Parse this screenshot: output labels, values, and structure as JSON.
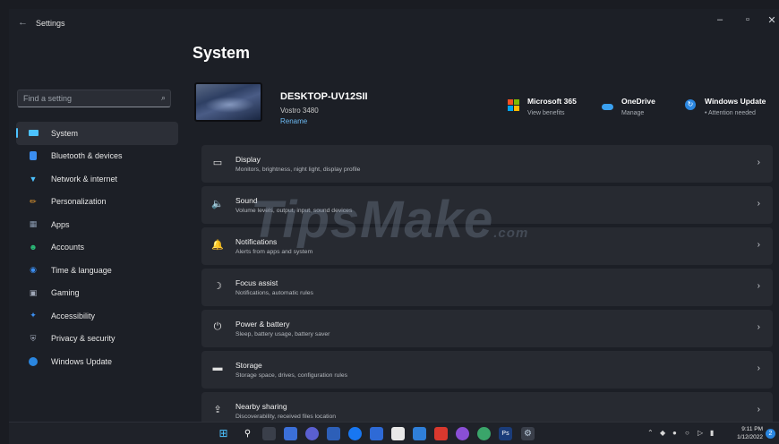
{
  "window": {
    "back_icon": "←",
    "title": "Settings",
    "minimize": "–",
    "maximize": "▫",
    "close": "✕"
  },
  "search": {
    "placeholder": "Find a setting",
    "icon": "search-icon"
  },
  "sidebar": {
    "items": [
      {
        "label": "System",
        "icon": "system-icon",
        "active": true,
        "color": "#4cc2ff"
      },
      {
        "label": "Bluetooth & devices",
        "icon": "bluetooth-icon",
        "color": "#3b8ef0"
      },
      {
        "label": "Network & internet",
        "icon": "wifi-icon",
        "color": "#4cc2ff"
      },
      {
        "label": "Personalization",
        "icon": "brush-icon",
        "color": "#f0a030"
      },
      {
        "label": "Apps",
        "icon": "apps-icon",
        "color": "#8a9ab0"
      },
      {
        "label": "Accounts",
        "icon": "person-icon",
        "color": "#2bbf7a"
      },
      {
        "label": "Time & language",
        "icon": "globe-icon",
        "color": "#3b8ef0"
      },
      {
        "label": "Gaming",
        "icon": "controller-icon",
        "color": "#a0a8b8"
      },
      {
        "label": "Accessibility",
        "icon": "accessibility-icon",
        "color": "#3b8ef0"
      },
      {
        "label": "Privacy & security",
        "icon": "shield-icon",
        "color": "#a0a8b8"
      },
      {
        "label": "Windows Update",
        "icon": "update-icon",
        "color": "#2a86e0"
      }
    ]
  },
  "main": {
    "title": "System",
    "device": {
      "name": "DESKTOP-UV12SII",
      "model": "Vostro 3480",
      "rename": "Rename"
    },
    "quick": [
      {
        "title": "Microsoft 365",
        "sub": "View benefits",
        "icon": "microsoft-365-icon"
      },
      {
        "title": "OneDrive",
        "sub": "Manage",
        "icon": "onedrive-icon"
      },
      {
        "title": "Windows Update",
        "sub": "• Attention needed",
        "icon": "windows-update-icon"
      }
    ],
    "cards": [
      {
        "title": "Display",
        "sub": "Monitors, brightness, night light, display profile",
        "glyph": "▭",
        "icon": "display-icon"
      },
      {
        "title": "Sound",
        "sub": "Volume levels, output, input, sound devices",
        "glyph": "🔈",
        "icon": "speaker-icon"
      },
      {
        "title": "Notifications",
        "sub": "Alerts from apps and system",
        "glyph": "🔔",
        "icon": "bell-icon"
      },
      {
        "title": "Focus assist",
        "sub": "Notifications, automatic rules",
        "glyph": "☽",
        "icon": "moon-icon"
      },
      {
        "title": "Power & battery",
        "sub": "Sleep, battery usage, battery saver",
        "glyph": "⏻",
        "icon": "power-icon"
      },
      {
        "title": "Storage",
        "sub": "Storage space, drives, configuration rules",
        "glyph": "▬",
        "icon": "storage-icon"
      },
      {
        "title": "Nearby sharing",
        "sub": "Discoverability, received files location",
        "glyph": "⇪",
        "icon": "share-icon"
      }
    ],
    "chevron": "›"
  },
  "watermark": {
    "main": "TipsMake",
    "suffix": ".com"
  },
  "taskbar": {
    "time": "9:11 PM",
    "date": "1/12/2022",
    "notification_count": "2"
  }
}
